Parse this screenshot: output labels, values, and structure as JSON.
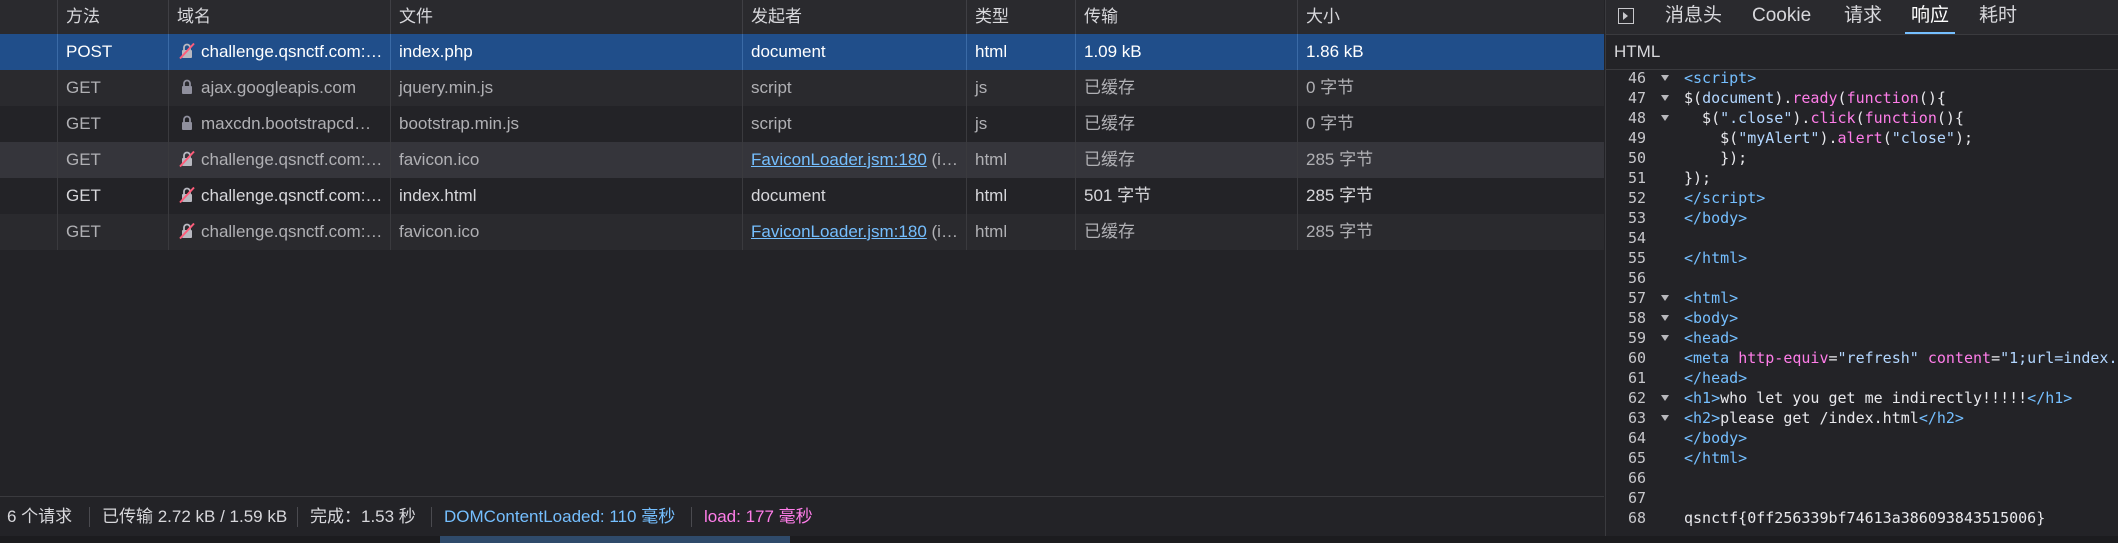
{
  "table": {
    "columns": [
      "方法",
      "域名",
      "文件",
      "发起者",
      "类型",
      "传输",
      "大小"
    ],
    "rows": [
      {
        "method": "POST",
        "domain": "challenge.qsnctf.com:…",
        "file": "index.php",
        "initiator": "document",
        "initiator_suffix": "",
        "type": "html",
        "transferred": "1.09 kB",
        "size": "1.86 kB",
        "lock": "broken"
      },
      {
        "method": "GET",
        "domain": "ajax.googleapis.com",
        "file": "jquery.min.js",
        "initiator": "script",
        "initiator_suffix": "",
        "type": "js",
        "transferred": "已缓存",
        "size": "0 字节",
        "lock": "secure"
      },
      {
        "method": "GET",
        "domain": "maxcdn.bootstrapcd…",
        "file": "bootstrap.min.js",
        "initiator": "script",
        "initiator_suffix": "",
        "type": "js",
        "transferred": "已缓存",
        "size": "0 字节",
        "lock": "secure"
      },
      {
        "method": "GET",
        "domain": "challenge.qsnctf.com:…",
        "file": "favicon.ico",
        "initiator": "FaviconLoader.jsm:180",
        "initiator_suffix": " (i…",
        "type": "html",
        "transferred": "已缓存",
        "size": "285 字节",
        "lock": "broken"
      },
      {
        "method": "GET",
        "domain": "challenge.qsnctf.com:…",
        "file": "index.html",
        "initiator": "document",
        "initiator_suffix": "",
        "type": "html",
        "transferred": "501 字节",
        "size": "285 字节",
        "lock": "broken"
      },
      {
        "method": "GET",
        "domain": "challenge.qsnctf.com:…",
        "file": "favicon.ico",
        "initiator": "FaviconLoader.jsm:180",
        "initiator_suffix": " (i…",
        "type": "html",
        "transferred": "已缓存",
        "size": "285 字节",
        "lock": "broken"
      }
    ]
  },
  "status": {
    "requests": "6 个请求",
    "transferred": "已传输 2.72 kB / 1.59 kB",
    "finish": "完成：1.53 秒",
    "dcl": "DOMContentLoaded: 110 毫秒",
    "load": "load: 177 毫秒"
  },
  "panel": {
    "tabs": [
      "消息头",
      "Cookie",
      "请求",
      "响应",
      "耗时"
    ],
    "active_tab": "响应",
    "format": "HTML"
  },
  "colors": {
    "selected_row": "#204e8a",
    "tag": "#75bfff",
    "attr": "#ff7de9",
    "link": "#75bfff"
  }
}
